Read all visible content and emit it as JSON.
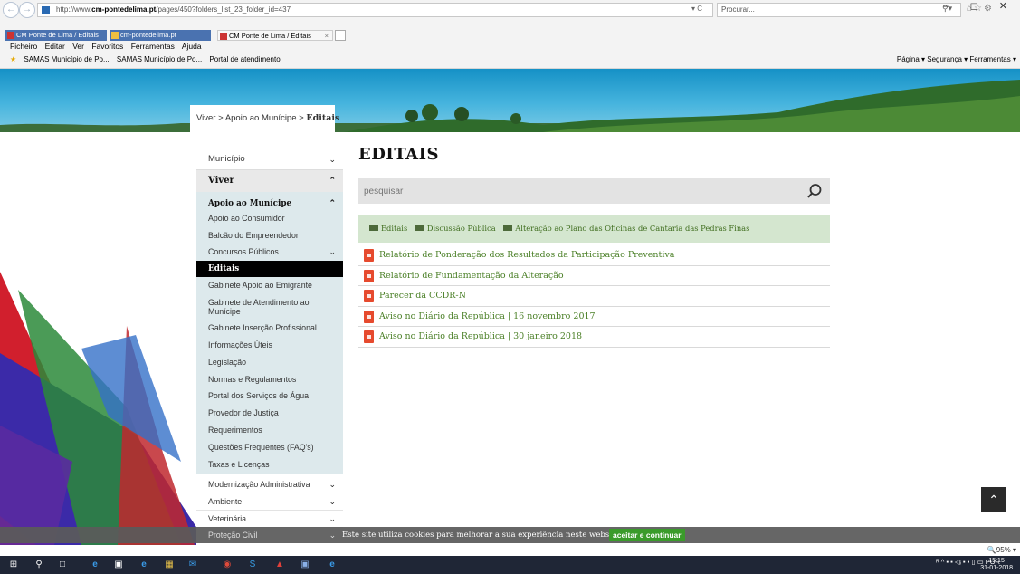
{
  "browser": {
    "url_prefix": "http://www.",
    "url_domain": "cm-pontedelima.pt",
    "url_path": "/pages/450?folders_list_23_folder_id=437",
    "address_tools": "▾ C",
    "search_placeholder": "Procurar...",
    "window_controls": "–  ◻  ✕",
    "tabs": [
      {
        "label": "CM Ponte de Lima / Editais"
      },
      {
        "label": "cm-pontedelima.pt"
      },
      {
        "label": "CM Ponte de Lima / Editais",
        "close": "×"
      }
    ],
    "menu": [
      "Ficheiro",
      "Editar",
      "Ver",
      "Favoritos",
      "Ferramentas",
      "Ajuda"
    ],
    "favorites": [
      "SAMAS Município de Po...",
      "SAMAS Município de Po...",
      "Portal de atendimento"
    ],
    "commands": "Página ▾  Segurança ▾  Ferramentas ▾",
    "zoom": "🔍95% ▾"
  },
  "breadcrumb": {
    "items": [
      "Viver",
      "Apoio ao Munícipe"
    ],
    "separator": ">",
    "current": "Editais"
  },
  "sidebar": {
    "top": [
      {
        "label": "Município"
      },
      {
        "label": "Viver"
      }
    ],
    "sub": [
      {
        "label": "Apoio ao Munícipe",
        "bold": true,
        "chevron": "up"
      },
      {
        "label": "Apoio ao Consumidor"
      },
      {
        "label": "Balcão do Empreendedor"
      },
      {
        "label": "Concursos Públicos",
        "chevron": "down"
      },
      {
        "label": "Editais",
        "active": true
      },
      {
        "label": "Gabinete Apoio ao Emigrante"
      },
      {
        "label": "Gabinete de Atendimento ao Munícipe"
      },
      {
        "label": "Gabinete Inserção Profissional"
      },
      {
        "label": "Informações Úteis"
      },
      {
        "label": "Legislação"
      },
      {
        "label": "Normas e Regulamentos"
      },
      {
        "label": "Portal dos Serviços de Água"
      },
      {
        "label": "Provedor de Justiça"
      },
      {
        "label": "Requerimentos"
      },
      {
        "label": "Questões Frequentes (FAQ's)"
      },
      {
        "label": "Taxas e Licenças"
      }
    ],
    "lower": [
      {
        "label": "Modernização Administrativa"
      },
      {
        "label": "Ambiente"
      },
      {
        "label": "Veterinária"
      },
      {
        "label": "Proteção Civil"
      }
    ]
  },
  "main": {
    "title": "EDITAIS",
    "search_placeholder": "pesquisar",
    "folders": [
      "Editais",
      "Discussão Pública",
      "Alteração ao Plano das Oficinas de Cantaria das Pedras Finas"
    ],
    "documents": [
      "Relatório de Ponderação dos Resultados da Participação Preventiva",
      "Relatório de Fundamentação da Alteração",
      "Parecer da CCDR-N",
      "Aviso no Diário da República | 16 novembro 2017",
      "Aviso no Diário da República | 30 janeiro 2018"
    ]
  },
  "cookie": {
    "text": "Este site utiliza cookies para melhorar a sua experiência neste website.",
    "button": "aceitar e continuar"
  },
  "taskbar": {
    "tray": "ᴿ  ^  ▪ ▪ ◁ᵢ  ▪ ▪ ▯ ▭  POR",
    "time": "15:15",
    "date": "31-01-2018"
  },
  "colors": {
    "accent_green": "#4a7f26",
    "folder_bar": "#d4e6cf",
    "sidebar_sub": "#dde9ec",
    "pdf_red": "#e64a2e",
    "cookie_button": "#3a9b2a"
  }
}
